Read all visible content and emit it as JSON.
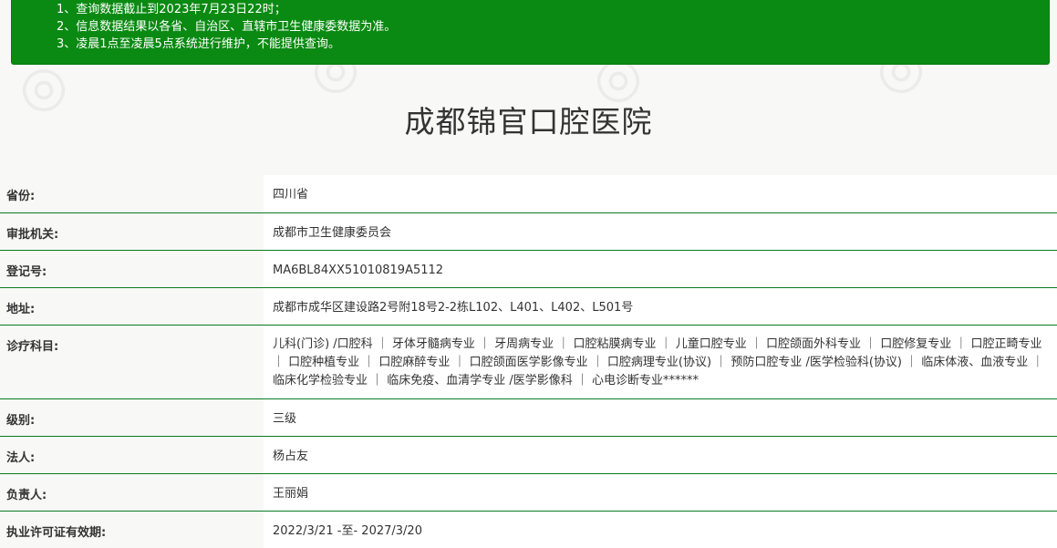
{
  "notice": {
    "lines": [
      "1、查询数据截止到2023年7月23日22时；",
      "2、信息数据结果以各省、自治区、直辖市卫生健康委数据为准。",
      "3、凌晨1点至凌晨5点系统进行维护，不能提供查询。"
    ]
  },
  "hospital": {
    "name": "成都锦官口腔医院"
  },
  "details": [
    {
      "label": "省份:",
      "value": "四川省"
    },
    {
      "label": "审批机关:",
      "value": "成都市卫生健康委员会"
    },
    {
      "label": "登记号:",
      "value": "MA6BL84XX51010819A5112"
    },
    {
      "label": "地址:",
      "value": "成都市成华区建设路2号附18号2-2栋L102、L401、L402、L501号"
    },
    {
      "label": "诊疗科目:",
      "value": "儿科(门诊) /口腔科 ｜ 牙体牙髓病专业 ｜ 牙周病专业 ｜ 口腔粘膜病专业 ｜ 儿童口腔专业 ｜ 口腔颌面外科专业 ｜ 口腔修复专业 ｜ 口腔正畸专业 ｜ 口腔种植专业 ｜ 口腔麻醉专业 ｜ 口腔颌面医学影像专业 ｜ 口腔病理专业(协议) ｜ 预防口腔专业 /医学检验科(协议) ｜ 临床体液、血液专业 ｜ 临床化学检验专业 ｜ 临床免疫、血清学专业 /医学影像科 ｜ 心电诊断专业******"
    },
    {
      "label": "级别:",
      "value": "三级"
    },
    {
      "label": "法人:",
      "value": "杨占友"
    },
    {
      "label": "负责人:",
      "value": "王丽娟"
    },
    {
      "label": "执业许可证有效期:",
      "value": "2022/3/21 -至- 2027/3/20"
    }
  ],
  "colors": {
    "notice_bg": "#0a8a12",
    "row_border": "#0b7a23"
  }
}
